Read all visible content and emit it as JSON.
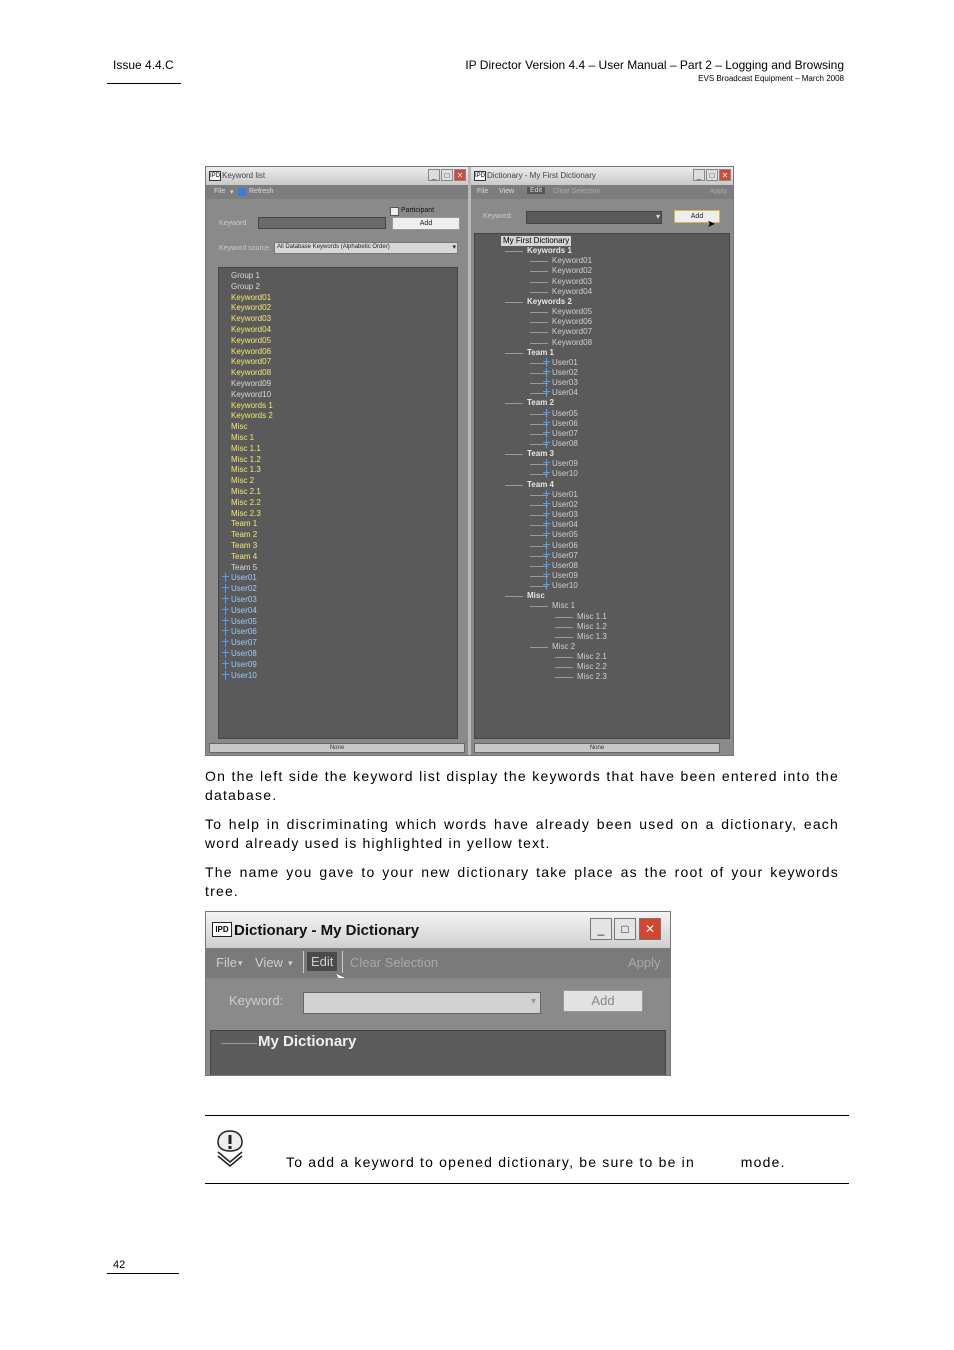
{
  "header": {
    "issue": "Issue 4.4.C",
    "title": "IP Director Version 4.4 – User Manual – Part 2 – Logging and Browsing",
    "subtitle": "EVS Broadcast Equipment – March 2008"
  },
  "footer": {
    "page_number": "42"
  },
  "screenshot1": {
    "keyword_window": {
      "title": "Keyword list",
      "menu_file": "File",
      "menu_refresh": "Refresh",
      "keyword_label": "Keyword",
      "participant_label": "Participant",
      "add_button": "Add",
      "source_label": "Keyword source",
      "source_value": "All Database Keywords (Alphabetic Order)",
      "items": [
        {
          "text": "Group 1",
          "style": "plain"
        },
        {
          "text": "Group 2",
          "style": "plain"
        },
        {
          "text": "Keyword01",
          "style": "used"
        },
        {
          "text": "Keyword02",
          "style": "used"
        },
        {
          "text": "Keyword03",
          "style": "used"
        },
        {
          "text": "Keyword04",
          "style": "used"
        },
        {
          "text": "Keyword05",
          "style": "used"
        },
        {
          "text": "Keyword06",
          "style": "used"
        },
        {
          "text": "Keyword07",
          "style": "used"
        },
        {
          "text": "Keyword08",
          "style": "used"
        },
        {
          "text": "Keyword09",
          "style": "plain"
        },
        {
          "text": "Keyword10",
          "style": "plain"
        },
        {
          "text": "Keywords 1",
          "style": "used"
        },
        {
          "text": "Keywords 2",
          "style": "used"
        },
        {
          "text": "Misc",
          "style": "used"
        },
        {
          "text": "Misc 1",
          "style": "used"
        },
        {
          "text": "Misc 1.1",
          "style": "used"
        },
        {
          "text": "Misc 1.2",
          "style": "used"
        },
        {
          "text": "Misc 1.3",
          "style": "used"
        },
        {
          "text": "Misc 2",
          "style": "used"
        },
        {
          "text": "Misc 2.1",
          "style": "used"
        },
        {
          "text": "Misc 2.2",
          "style": "used"
        },
        {
          "text": "Misc 2.3",
          "style": "used"
        },
        {
          "text": "Team 1",
          "style": "used"
        },
        {
          "text": "Team 2",
          "style": "used"
        },
        {
          "text": "Team 3",
          "style": "used"
        },
        {
          "text": "Team 4",
          "style": "used"
        },
        {
          "text": "Team 5",
          "style": "plain"
        },
        {
          "text": "User01",
          "style": "user"
        },
        {
          "text": "User02",
          "style": "user"
        },
        {
          "text": "User03",
          "style": "user"
        },
        {
          "text": "User04",
          "style": "user"
        },
        {
          "text": "User05",
          "style": "user"
        },
        {
          "text": "User06",
          "style": "user"
        },
        {
          "text": "User07",
          "style": "user"
        },
        {
          "text": "User08",
          "style": "user"
        },
        {
          "text": "User09",
          "style": "user"
        },
        {
          "text": "User10",
          "style": "user"
        }
      ],
      "status": "None"
    },
    "dictionary_window": {
      "title": "Dictionary - My First Dictionary",
      "menu_file": "File",
      "menu_view": "View",
      "menu_edit": "Edit",
      "menu_clear": "Clear Selection",
      "menu_apply": "Apply",
      "keyword_label": "Keyword:",
      "add_button": "Add",
      "tree": [
        {
          "text": "My First Dictionary",
          "level": 0,
          "root": true
        },
        {
          "text": "Keywords 1",
          "level": 1
        },
        {
          "text": "Keyword01",
          "level": 2
        },
        {
          "text": "Keyword02",
          "level": 2
        },
        {
          "text": "Keyword03",
          "level": 2
        },
        {
          "text": "Keyword04",
          "level": 2
        },
        {
          "text": "Keywords 2",
          "level": 1
        },
        {
          "text": "Keyword05",
          "level": 2
        },
        {
          "text": "Keyword06",
          "level": 2
        },
        {
          "text": "Keyword07",
          "level": 2
        },
        {
          "text": "Keyword08",
          "level": 2
        },
        {
          "text": "Team 1",
          "level": 1
        },
        {
          "text": "User01",
          "level": 2,
          "user": true
        },
        {
          "text": "User02",
          "level": 2,
          "user": true
        },
        {
          "text": "User03",
          "level": 2,
          "user": true
        },
        {
          "text": "User04",
          "level": 2,
          "user": true
        },
        {
          "text": "Team 2",
          "level": 1
        },
        {
          "text": "User05",
          "level": 2,
          "user": true
        },
        {
          "text": "User06",
          "level": 2,
          "user": true
        },
        {
          "text": "User07",
          "level": 2,
          "user": true
        },
        {
          "text": "User08",
          "level": 2,
          "user": true
        },
        {
          "text": "Team 3",
          "level": 1
        },
        {
          "text": "User09",
          "level": 2,
          "user": true
        },
        {
          "text": "User10",
          "level": 2,
          "user": true
        },
        {
          "text": "Team 4",
          "level": 1
        },
        {
          "text": "User01",
          "level": 2,
          "user": true
        },
        {
          "text": "User02",
          "level": 2,
          "user": true
        },
        {
          "text": "User03",
          "level": 2,
          "user": true
        },
        {
          "text": "User04",
          "level": 2,
          "user": true
        },
        {
          "text": "User05",
          "level": 2,
          "user": true
        },
        {
          "text": "User06",
          "level": 2,
          "user": true
        },
        {
          "text": "User07",
          "level": 2,
          "user": true
        },
        {
          "text": "User08",
          "level": 2,
          "user": true
        },
        {
          "text": "User09",
          "level": 2,
          "user": true
        },
        {
          "text": "User10",
          "level": 2,
          "user": true
        },
        {
          "text": "Misc",
          "level": 1
        },
        {
          "text": "Misc 1",
          "level": 2
        },
        {
          "text": "Misc 1.1",
          "level": 3
        },
        {
          "text": "Misc 1.2",
          "level": 3
        },
        {
          "text": "Misc 1.3",
          "level": 3
        },
        {
          "text": "Misc 2",
          "level": 2
        },
        {
          "text": "Misc 2.1",
          "level": 3
        },
        {
          "text": "Misc 2.2",
          "level": 3
        },
        {
          "text": "Misc 2.3",
          "level": 3
        }
      ],
      "status": "None"
    }
  },
  "paragraphs": [
    "On the left side the keyword list display the keywords that have been entered into the database.",
    "To help in discriminating which words have already been used on a dictionary, each word already used is highlighted in yellow text.",
    "The name you gave to your new dictionary take place as the root of your keywords tree."
  ],
  "screenshot2": {
    "logo": "IPD",
    "title": "Dictionary - My Dictionary",
    "menu_file": "File",
    "menu_view": "View",
    "menu_edit": "Edit",
    "menu_clear": "Clear Selection",
    "menu_apply": "Apply",
    "keyword_label": "Keyword:",
    "add_button": "Add",
    "tree_root": "My Dictionary"
  },
  "note": {
    "text": "To add a keyword to opened dictionary, be sure to be in         mode."
  },
  "colors": {
    "used_keyword": "#f2e873",
    "user_icon": "#4fa1ff",
    "panel_dark": "#5a5a5a"
  }
}
